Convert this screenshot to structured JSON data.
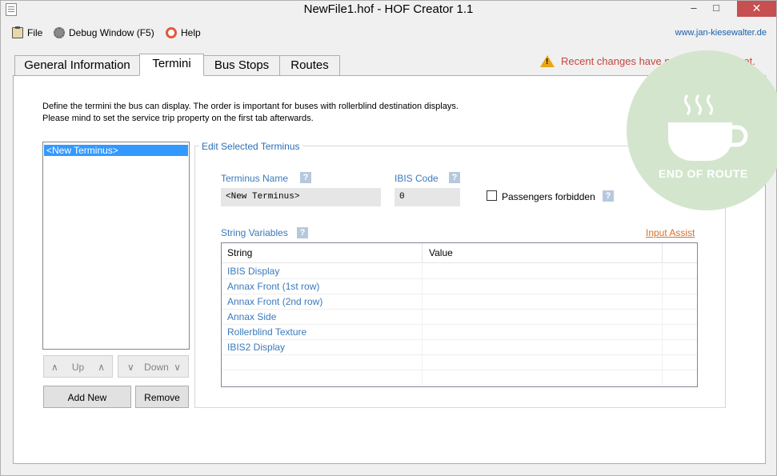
{
  "window": {
    "title": "NewFile1.hof - HOF Creator 1.1",
    "controls": {
      "minimize": "–",
      "maximize": "□",
      "close": "✕"
    }
  },
  "menu": {
    "file": "File",
    "debug": "Debug Window (F5)",
    "help": "Help",
    "website": "www.jan-kiesewalter.de"
  },
  "tabs": [
    {
      "label": "General Information",
      "active": false
    },
    {
      "label": "Termini",
      "active": true
    },
    {
      "label": "Bus Stops",
      "active": false
    },
    {
      "label": "Routes",
      "active": false
    }
  ],
  "status": {
    "unsaved": "Recent changes have not been saved yet."
  },
  "badge": {
    "text": "END OF ROUTE"
  },
  "description": {
    "line1": "Define the termini the bus can display. The order is important for buses with rollerblind destination displays.",
    "line2": "Please mind to set the service trip property on the first tab afterwards."
  },
  "termini_list": [
    "<New Terminus>"
  ],
  "list_buttons": {
    "up": "Up",
    "down": "Down",
    "add_new": "Add New",
    "remove": "Remove",
    "up_arrow": "∧",
    "down_arrow": "∨"
  },
  "edit": {
    "group_title": "Edit Selected Terminus",
    "name_label": "Terminus Name",
    "name_value": "<New Terminus>",
    "ibis_label": "IBIS Code",
    "ibis_value": "0",
    "passengers_label": "Passengers forbidden",
    "passengers_checked": false,
    "help_mark": "?",
    "string_vars_label": "String Variables",
    "input_assist": "Input Assist"
  },
  "grid": {
    "headers": [
      "String",
      "Value"
    ],
    "rows": [
      {
        "string": "IBIS Display",
        "value": ""
      },
      {
        "string": "Annax Front (1st row)",
        "value": ""
      },
      {
        "string": "Annax Front (2nd row)",
        "value": ""
      },
      {
        "string": "Annax Side",
        "value": ""
      },
      {
        "string": "Rollerblind Texture",
        "value": ""
      },
      {
        "string": "IBIS2 Display",
        "value": ""
      },
      {
        "string": "",
        "value": ""
      },
      {
        "string": "",
        "value": ""
      }
    ]
  },
  "colors": {
    "accent_blue": "#3a7abc",
    "selection": "#3399ff",
    "warning": "#c5463d",
    "link_orange": "#d4722a",
    "badge_green": "#d3e6cd"
  }
}
